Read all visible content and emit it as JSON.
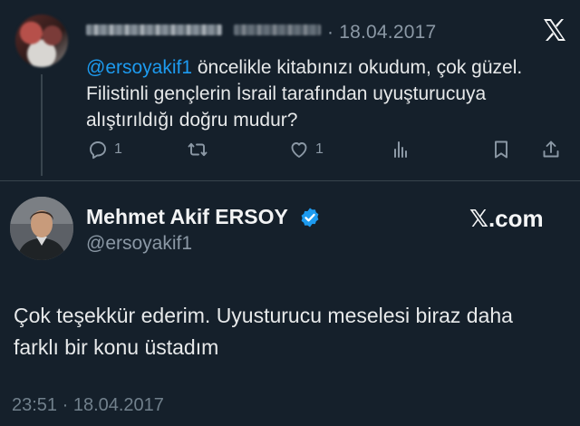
{
  "reply_tweet": {
    "date": "· 18.04.2017",
    "mention": "@ersoyakif1",
    "text": " öncelikle kitabınızı okudum, çok güzel. Filistinli gençlerin İsrail tarafından uyuşturucuya alıştırıldığı doğru mudur?",
    "actions": {
      "replies": "1",
      "likes": "1"
    }
  },
  "main_tweet": {
    "author_name": "Mehmet Akif ERSOY",
    "handle": "@ersoyakif1",
    "brand": "𝕏.com",
    "text": "Çok teşekkür ederim. Uyusturucu meselesi biraz daha farklı bir konu üstadım",
    "timestamp": "23:51 · 18.04.2017"
  },
  "colors": {
    "background": "#15202b",
    "accent": "#1d9bf0",
    "muted": "#8b98a5",
    "verified": "#1d9bf0"
  },
  "icons": [
    "close-x-icon",
    "reply-icon",
    "retweet-icon",
    "like-icon",
    "views-icon",
    "bookmark-icon",
    "share-icon",
    "verified-badge-icon"
  ]
}
